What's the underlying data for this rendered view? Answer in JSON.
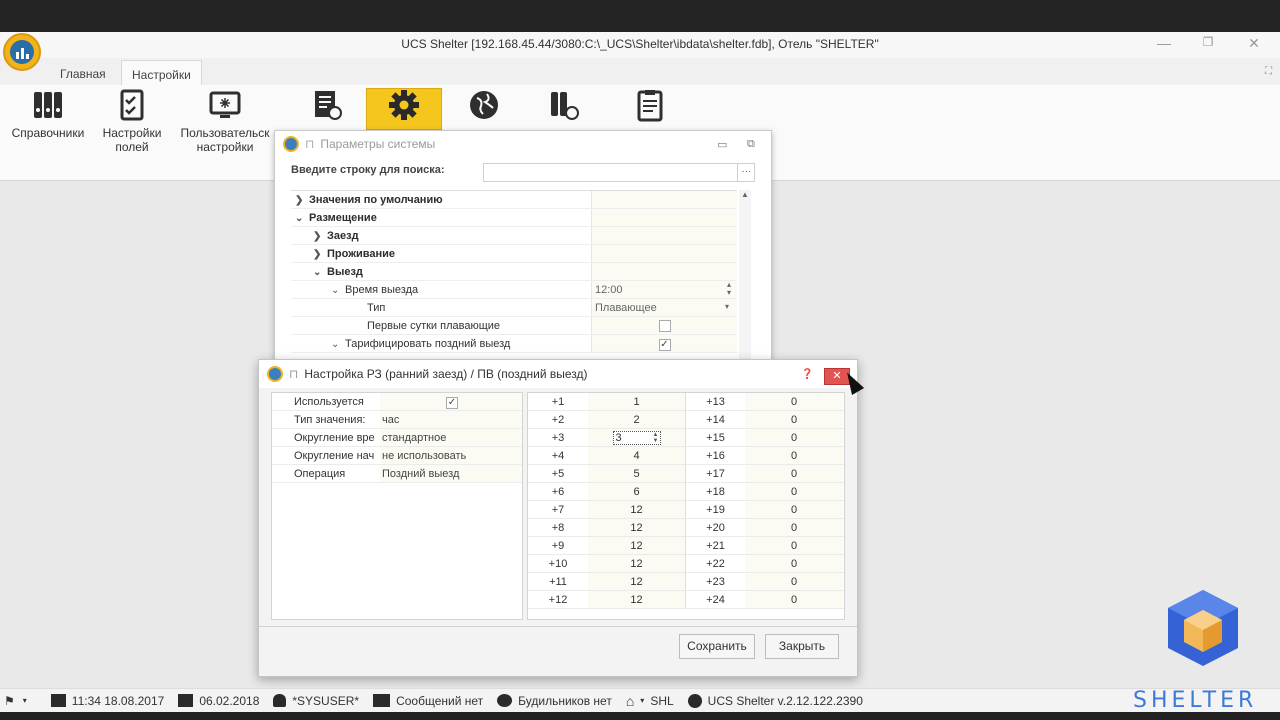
{
  "window": {
    "title": "UCS Shelter [192.168.45.44/3080:C:\\_UCS\\Shelter\\ibdata\\shelter.fdb], Отель \"SHELTER\""
  },
  "ribbon_tabs": [
    "Главная",
    "Настройки"
  ],
  "ribbon_buttons": {
    "dictionaries": "Справочники",
    "fields_line1": "Настройки",
    "fields_line2": "полей",
    "user_line1": "Пользовательск",
    "user_line2": "настройки"
  },
  "sys_dialog": {
    "title": "Параметры системы",
    "search_label": "Введите строку для поиска:",
    "tree": [
      {
        "label": "Значения по умолчанию",
        "value": ""
      },
      {
        "label": "Размещение",
        "value": ""
      },
      {
        "label": "Заезд",
        "value": ""
      },
      {
        "label": "Проживание",
        "value": ""
      },
      {
        "label": "Выезд",
        "value": ""
      },
      {
        "label": "Время выезда",
        "value": "12:00"
      },
      {
        "label": "Тип",
        "value": "Плавающее"
      },
      {
        "label": "Первые сутки плавающие",
        "value": ""
      },
      {
        "label": "Тарифицировать поздний выезд",
        "value": ""
      }
    ]
  },
  "main_dialog": {
    "title": "Настройка РЗ (ранний заезд) / ПВ (поздний выезд)",
    "props": [
      {
        "k": "Используется",
        "v": ""
      },
      {
        "k": "Тип значения:",
        "v": "час"
      },
      {
        "k": "Округление вре",
        "v": "стандартное"
      },
      {
        "k": "Округление нач",
        "v": "не использовать"
      },
      {
        "k": "Операция",
        "v": "Поздний выезд"
      }
    ],
    "grid": [
      [
        "+1",
        "1",
        "+13",
        "0"
      ],
      [
        "+2",
        "2",
        "+14",
        "0"
      ],
      [
        "+3",
        "3",
        "+15",
        "0"
      ],
      [
        "+4",
        "4",
        "+16",
        "0"
      ],
      [
        "+5",
        "5",
        "+17",
        "0"
      ],
      [
        "+6",
        "6",
        "+18",
        "0"
      ],
      [
        "+7",
        "12",
        "+19",
        "0"
      ],
      [
        "+8",
        "12",
        "+20",
        "0"
      ],
      [
        "+9",
        "12",
        "+21",
        "0"
      ],
      [
        "+10",
        "12",
        "+22",
        "0"
      ],
      [
        "+11",
        "12",
        "+23",
        "0"
      ],
      [
        "+12",
        "12",
        "+24",
        "0"
      ]
    ],
    "save_label": "Сохранить",
    "close_label": "Закрыть"
  },
  "status": {
    "datetime": "11:34 18.08.2017",
    "date": "06.02.2018",
    "user": "*SYSUSER*",
    "messages": "Сообщений нет",
    "alarms": "Будильников нет",
    "hotel": "SHL",
    "version": "UCS Shelter v.2.12.122.2390"
  },
  "brand": "SHELTER",
  "colors": {
    "accent": "#f5c61d",
    "close": "#e25450",
    "brand": "#3d7ad8"
  }
}
